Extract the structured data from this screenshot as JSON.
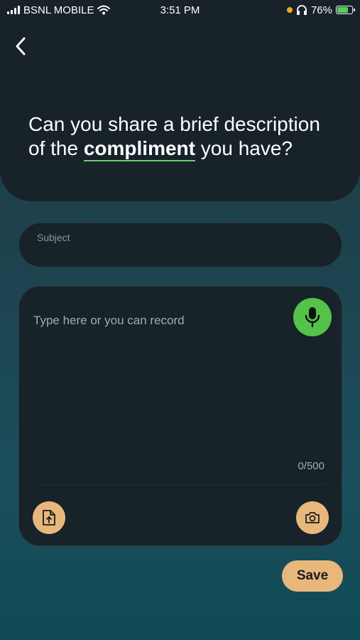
{
  "status_bar": {
    "carrier": "BSNL MOBILE",
    "time": "3:51 PM",
    "battery": "76%"
  },
  "header": {
    "question_before": "Can you share a brief description of the ",
    "question_highlight": "compliment",
    "question_after": " you have?"
  },
  "subject": {
    "label": "Subject",
    "value": ""
  },
  "description": {
    "placeholder": "Type here or you can record",
    "value": "",
    "counter": "0/500"
  },
  "actions": {
    "save_label": "Save"
  },
  "icons": {
    "back": "chevron-left-icon",
    "mic": "microphone-icon",
    "upload": "file-upload-icon",
    "camera": "camera-icon"
  },
  "colors": {
    "accent_green": "#55c24a",
    "accent_peach": "#e8b77c",
    "card_bg": "#172229"
  }
}
